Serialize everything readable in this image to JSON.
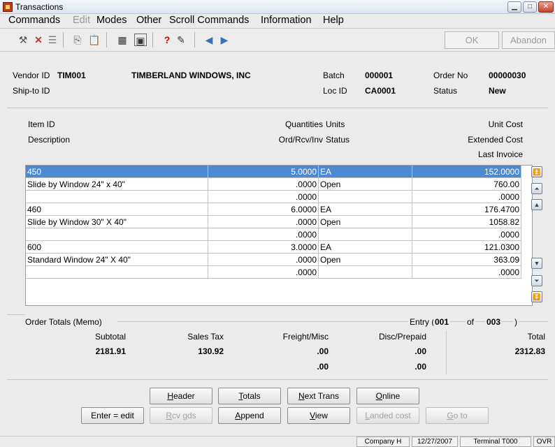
{
  "window": {
    "title": "Transactions",
    "min": "▁",
    "max": "□",
    "close": "✕"
  },
  "menu": [
    "Commands",
    "Edit",
    "Modes",
    "Other",
    "Scroll Commands",
    "Information",
    "Help"
  ],
  "toolbar": {
    "ok_label": "OK",
    "abandon_label": "Abandon"
  },
  "header": {
    "vendor_id_label": "Vendor ID",
    "vendor_id": "TIM001",
    "vendor_name": "TIMBERLAND WINDOWS, INC",
    "batch_label": "Batch",
    "batch": "000001",
    "order_no_label": "Order No",
    "order_no": "00000030",
    "shipto_label": "Ship-to ID",
    "loc_id_label": "Loc ID",
    "loc_id": "CA0001",
    "status_label": "Status",
    "status": "New"
  },
  "columns": {
    "item_id": "Item ID",
    "description": "Description",
    "quantities": "Quantities",
    "ord_rcv_inv": "Ord/Rcv/Inv",
    "units": "Units",
    "status": "Status",
    "unit_cost": "Unit Cost",
    "extended_cost": "Extended Cost",
    "last_invoice": "Last Invoice"
  },
  "lines": [
    {
      "item": "450",
      "qty": "5.0000",
      "unit": "EA",
      "unit_cost": "152.0000",
      "desc": "Slide by Window 24\" x 40\"",
      "rcv": ".0000",
      "status": "Open",
      "ext": "760.00",
      "inv": ".0000",
      "last": ".0000"
    },
    {
      "item": "460",
      "qty": "6.0000",
      "unit": "EA",
      "unit_cost": "176.4700",
      "desc": "Slide by Window 30\" X 40\"",
      "rcv": ".0000",
      "status": "Open",
      "ext": "1058.82",
      "inv": ".0000",
      "last": ".0000"
    },
    {
      "item": "600",
      "qty": "3.0000",
      "unit": "EA",
      "unit_cost": "121.0300",
      "desc": "Standard Window 24\" X 40\"",
      "rcv": ".0000",
      "status": "Open",
      "ext": "363.09",
      "inv": ".0000",
      "last": ".0000"
    }
  ],
  "totals": {
    "section_label": "Order Totals (Memo)",
    "entry_label": "Entry (",
    "entry": "001",
    "of_label": "of",
    "of_total": "003",
    "close_paren": ")",
    "subtotal_label": "Subtotal",
    "subtotal": "2181.91",
    "sales_tax_label": "Sales Tax",
    "sales_tax": "130.92",
    "freight_label": "Freight/Misc",
    "freight1": ".00",
    "freight2": ".00",
    "disc_label": "Disc/Prepaid",
    "disc1": ".00",
    "disc2": ".00",
    "total_label": "Total",
    "total": "2312.83"
  },
  "buttons": {
    "header": {
      "u": "H",
      "rest": "eader"
    },
    "totals": {
      "u": "T",
      "rest": "otals"
    },
    "next_trans": {
      "u": "N",
      "rest": "ext Trans"
    },
    "online": {
      "u": "O",
      "rest": "nline"
    },
    "enter_edit": "Enter = edit",
    "rcv_gds": {
      "u": "R",
      "rest": "cv gds"
    },
    "append": {
      "u": "A",
      "rest": "ppend"
    },
    "view": {
      "u": "V",
      "rest": "iew"
    },
    "landed_cost": {
      "u": "L",
      "rest": "anded cost"
    },
    "go_to": {
      "u": "G",
      "rest": "o to"
    }
  },
  "statusbar": {
    "company": "Company H",
    "date": "12/27/2007",
    "terminal": "Terminal T000",
    "mode": "OVR"
  }
}
